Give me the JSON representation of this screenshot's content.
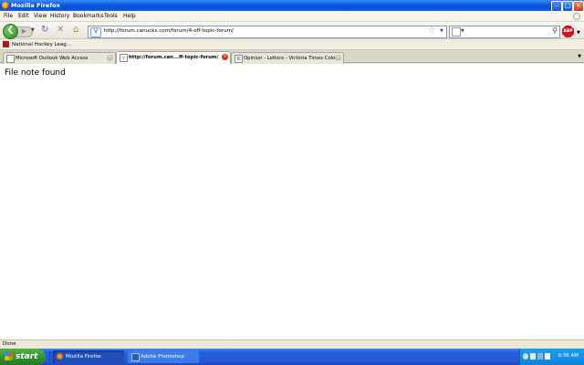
{
  "window": {
    "title": "Mozilla Firefox"
  },
  "menu": [
    "File",
    "Edit",
    "View",
    "History",
    "Bookmarks",
    "Tools",
    "Help"
  ],
  "nav": {
    "url": "http://forum.canucks.com/forum/4-off-topic-forum/",
    "search_value": ""
  },
  "bookmarks": [
    {
      "label": "National Hockey Leag..."
    }
  ],
  "tabs": [
    {
      "label": "Microsoft Outlook Web Access",
      "active": false
    },
    {
      "label": "http://forum.can...ff-topic-forum/",
      "active": true
    },
    {
      "label": "Opinion - Letters - Victoria Times Colonist",
      "active": false
    }
  ],
  "content": {
    "message": "File note found"
  },
  "status": {
    "text": "Done"
  },
  "taskbar": {
    "start_label": "start",
    "tasks": [
      {
        "label": "Mozilla Firefox",
        "icon": "firefox-icon",
        "active": true
      },
      {
        "label": "Adobe Photoshop",
        "icon": "photoshop-icon",
        "active": false
      }
    ],
    "clock": "9:36 AM"
  },
  "colors": {
    "titlebar": "#0a58e0",
    "taskbar": "#245edc",
    "start": "#2f8f2c"
  }
}
